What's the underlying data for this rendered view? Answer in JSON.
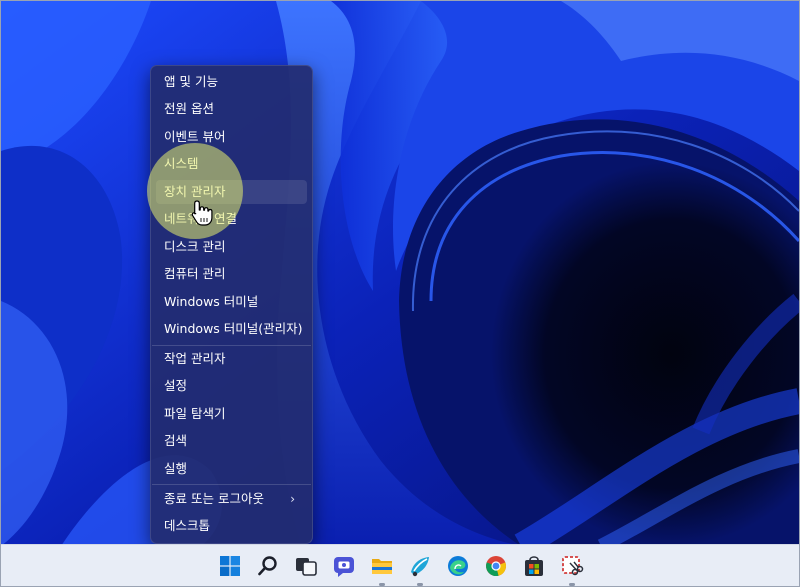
{
  "menu": {
    "items": [
      {
        "label": "앱 및 기능"
      },
      {
        "label": "전원 옵션"
      },
      {
        "label": "이벤트 뷰어"
      },
      {
        "label": "시스템"
      },
      {
        "label": "장치 관리자"
      },
      {
        "label": "네트워크 연결"
      },
      {
        "label": "디스크 관리"
      },
      {
        "label": "컴퓨터 관리"
      },
      {
        "label": "Windows 터미널"
      },
      {
        "label": "Windows 터미널(관리자)"
      },
      {
        "label": "작업 관리자"
      },
      {
        "label": "설정"
      },
      {
        "label": "파일 탐색기"
      },
      {
        "label": "검색"
      },
      {
        "label": "실행"
      },
      {
        "label": "종료 또는 로그아웃"
      },
      {
        "label": "데스크톱"
      }
    ],
    "hovered_item": "장치 관리자",
    "submenu_chevron": "chevron-right-icon"
  },
  "taskbar": {
    "icons": [
      "windows-start-icon",
      "search-icon",
      "task-view-icon",
      "chat-icon",
      "file-explorer-icon",
      "paint-icon",
      "edge-icon",
      "chrome-icon",
      "store-icon",
      "snipping-tool-icon"
    ]
  },
  "colors": {
    "accent_highlight": "#e8f06e",
    "menu_background": "#222c70",
    "taskbar": "#e8edf6",
    "wallpaper_dark": "#02072a",
    "wallpaper_blue": "#1a3cff"
  }
}
